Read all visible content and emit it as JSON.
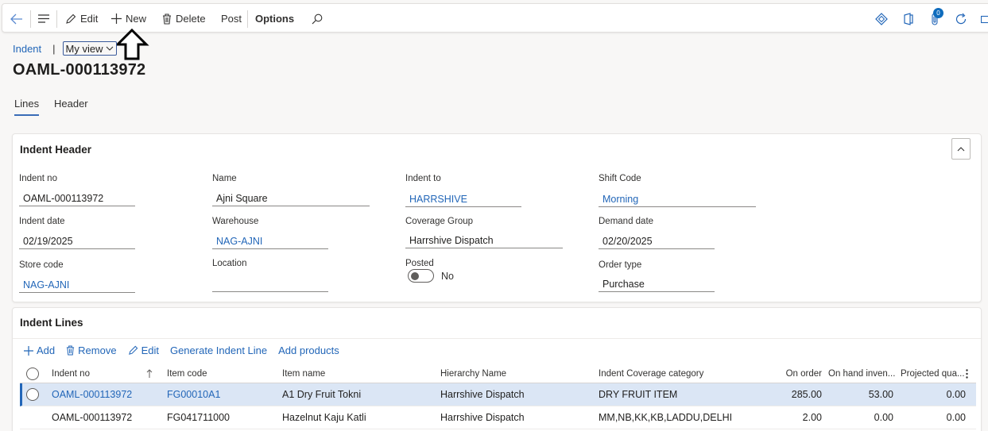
{
  "toolbar": {
    "edit_label": "Edit",
    "new_label": "New",
    "delete_label": "Delete",
    "post_label": "Post",
    "options_label": "Options",
    "notification_count": "0"
  },
  "breadcrumb": {
    "link": "Indent",
    "separator": "|",
    "view_label": "My view"
  },
  "page_title": "OAML-000113972",
  "tabs": [
    {
      "label": "Lines"
    },
    {
      "label": "Header"
    }
  ],
  "indent_header": {
    "title": "Indent Header",
    "fields": {
      "indent_no": {
        "label": "Indent no",
        "value": "OAML-000113972"
      },
      "name": {
        "label": "Name",
        "value": "Ajni Square"
      },
      "indent_to": {
        "label": "Indent to",
        "value": "HARRSHIVE"
      },
      "shift_code": {
        "label": "Shift Code",
        "value": "Morning"
      },
      "indent_date": {
        "label": "Indent date",
        "value": "02/19/2025"
      },
      "warehouse": {
        "label": "Warehouse",
        "value": "NAG-AJNI"
      },
      "coverage_group": {
        "label": "Coverage Group",
        "value": "Harrshive Dispatch"
      },
      "demand_date": {
        "label": "Demand date",
        "value": "02/20/2025"
      },
      "store_code": {
        "label": "Store code",
        "value": "NAG-AJNI"
      },
      "location": {
        "label": "Location",
        "value": ""
      },
      "posted": {
        "label": "Posted",
        "value": "No"
      },
      "order_type": {
        "label": "Order type",
        "value": "Purchase"
      }
    }
  },
  "indent_lines": {
    "title": "Indent Lines",
    "actions": {
      "add": "Add",
      "remove": "Remove",
      "edit": "Edit",
      "generate": "Generate Indent Line",
      "add_products": "Add products"
    },
    "columns": {
      "indent_no": "Indent no",
      "item_code": "Item code",
      "item_name": "Item name",
      "hierarchy": "Hierarchy Name",
      "category": "Indent Coverage category",
      "on_order": "On order",
      "on_hand": "On hand inven...",
      "projected": "Projected qua..."
    },
    "rows": [
      {
        "indent_no": "OAML-000113972",
        "item_code": "FG00010A1",
        "item_name": "A1 Dry Fruit Tokni",
        "hierarchy": "Harrshive Dispatch",
        "category": "DRY FRUIT ITEM",
        "on_order": "285.00",
        "on_hand": "53.00",
        "projected": "0.00"
      },
      {
        "indent_no": "OAML-000113972",
        "item_code": "FG041711000",
        "item_name": "Hazelnut Kaju Katli",
        "hierarchy": "Harrshive Dispatch",
        "category": "MM,NB,KK,KB,LADDU,DELHI",
        "on_order": "2.00",
        "on_hand": "0.00",
        "projected": "0.00"
      }
    ]
  }
}
